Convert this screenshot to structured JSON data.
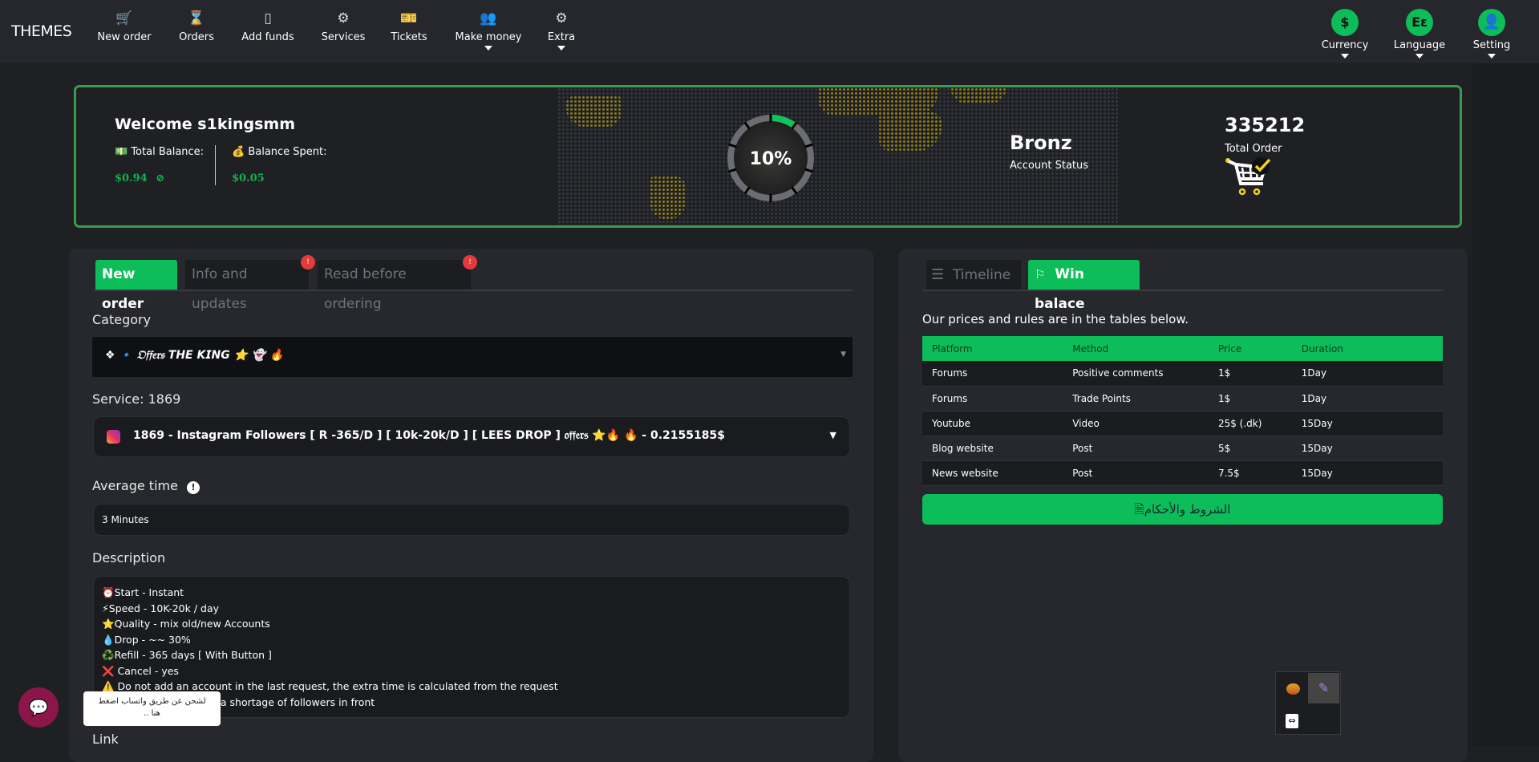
{
  "nav": {
    "brand": "THEMES",
    "items": [
      {
        "label": "New order",
        "icon": "cart-plus-icon",
        "glyph": "🛒"
      },
      {
        "label": "Orders",
        "icon": "orders-hourglass-icon",
        "glyph": "⌛"
      },
      {
        "label": "Add funds",
        "icon": "wallet-icon",
        "glyph": "▯"
      },
      {
        "label": "Services",
        "icon": "gear-icon",
        "glyph": "⚙"
      },
      {
        "label": "Tickets",
        "icon": "ticket-add-icon",
        "glyph": "🎫"
      },
      {
        "label": "Make money",
        "icon": "users-dollar-icon",
        "glyph": "👥",
        "dropdown": true
      },
      {
        "label": "Extra",
        "icon": "gear-icon",
        "glyph": "⚙",
        "dropdown": true
      }
    ],
    "right": [
      {
        "label": "Currency",
        "glyph": "$"
      },
      {
        "label": "Language",
        "glyph": "Eε"
      },
      {
        "label": "Setting",
        "glyph": "👤"
      }
    ]
  },
  "banner": {
    "welcome": "Welcome s1kingsmm",
    "total_balance_label": "Total Balance:",
    "total_balance": "$0.94",
    "balance_spent_label": "Balance Spent:",
    "balance_spent": "$0.05",
    "progress": "10%",
    "progress_value": 10,
    "status": "Bronz",
    "status_label": "Account Status",
    "total_orders": "335212",
    "total_orders_label": "Total Order"
  },
  "order": {
    "tabs": [
      {
        "label": "New order",
        "active": true
      },
      {
        "label": "Info and updates",
        "badge": "!"
      },
      {
        "label": "Read before ordering",
        "badge": "!"
      }
    ],
    "category_label": "Category",
    "category_value": "❖ 🔹 𝔒𝔣𝔣𝔢𝔯𝔰 𝙏𝙃𝙀 𝙆𝙄𝙉𝙂 ⭐ 👻 🔥",
    "service_label": "Service: 1869",
    "service_value": "1869 - Instagram Followers [ R -365/D ] [ 10k-20k/D ] [ LEES DROP ] 𝔬𝔣𝔣𝔢𝔯𝔰 ⭐🔥 🔥  - 0.2155185$",
    "avg_time_label": "Average time",
    "avg_time_value": "3 Minutes",
    "description_label": "Description",
    "description_lines": [
      "⏰Start - Instant",
      "⚡Speed - 10K-20k / day",
      "⭐Quality - mix old/new Accounts",
      "💧Drop - ~~ 30%",
      "♻️Refill - 365 days [ With Button ]",
      "❌ Cancel - yes",
      "⚠️ Do not add an account in the last request, the extra time is calculated from the request",
      "⚠️ Exception if there is a shortage of followers in front"
    ],
    "link_label": "Link"
  },
  "win": {
    "tabs": [
      {
        "label": "Timeline"
      },
      {
        "label": "Win balace",
        "active": true
      }
    ],
    "intro": "Our prices and rules are in the tables below.",
    "columns": [
      "Platform",
      "Method",
      "Price",
      "Duration"
    ],
    "rows": [
      [
        "Forums",
        "Positive comments",
        "1$",
        "1Day"
      ],
      [
        "Forums",
        "Trade Points",
        "1$",
        "1Day"
      ],
      [
        "Youtube",
        "Video",
        "25$ (.dk)",
        "15Day"
      ],
      [
        "Blog website",
        "Post",
        "5$",
        "15Day"
      ],
      [
        "News website",
        "Post",
        "7.5$",
        "15Day"
      ]
    ],
    "terms_button": "الشروط والأحكام"
  },
  "chat": {
    "tooltip": "لشحن عن طريق واتساب اضغط هنا .."
  },
  "colors": {
    "accent": "#0dbd59",
    "bg": "#1f2024",
    "panel": "#27282d",
    "badge": "#e33b3b"
  }
}
